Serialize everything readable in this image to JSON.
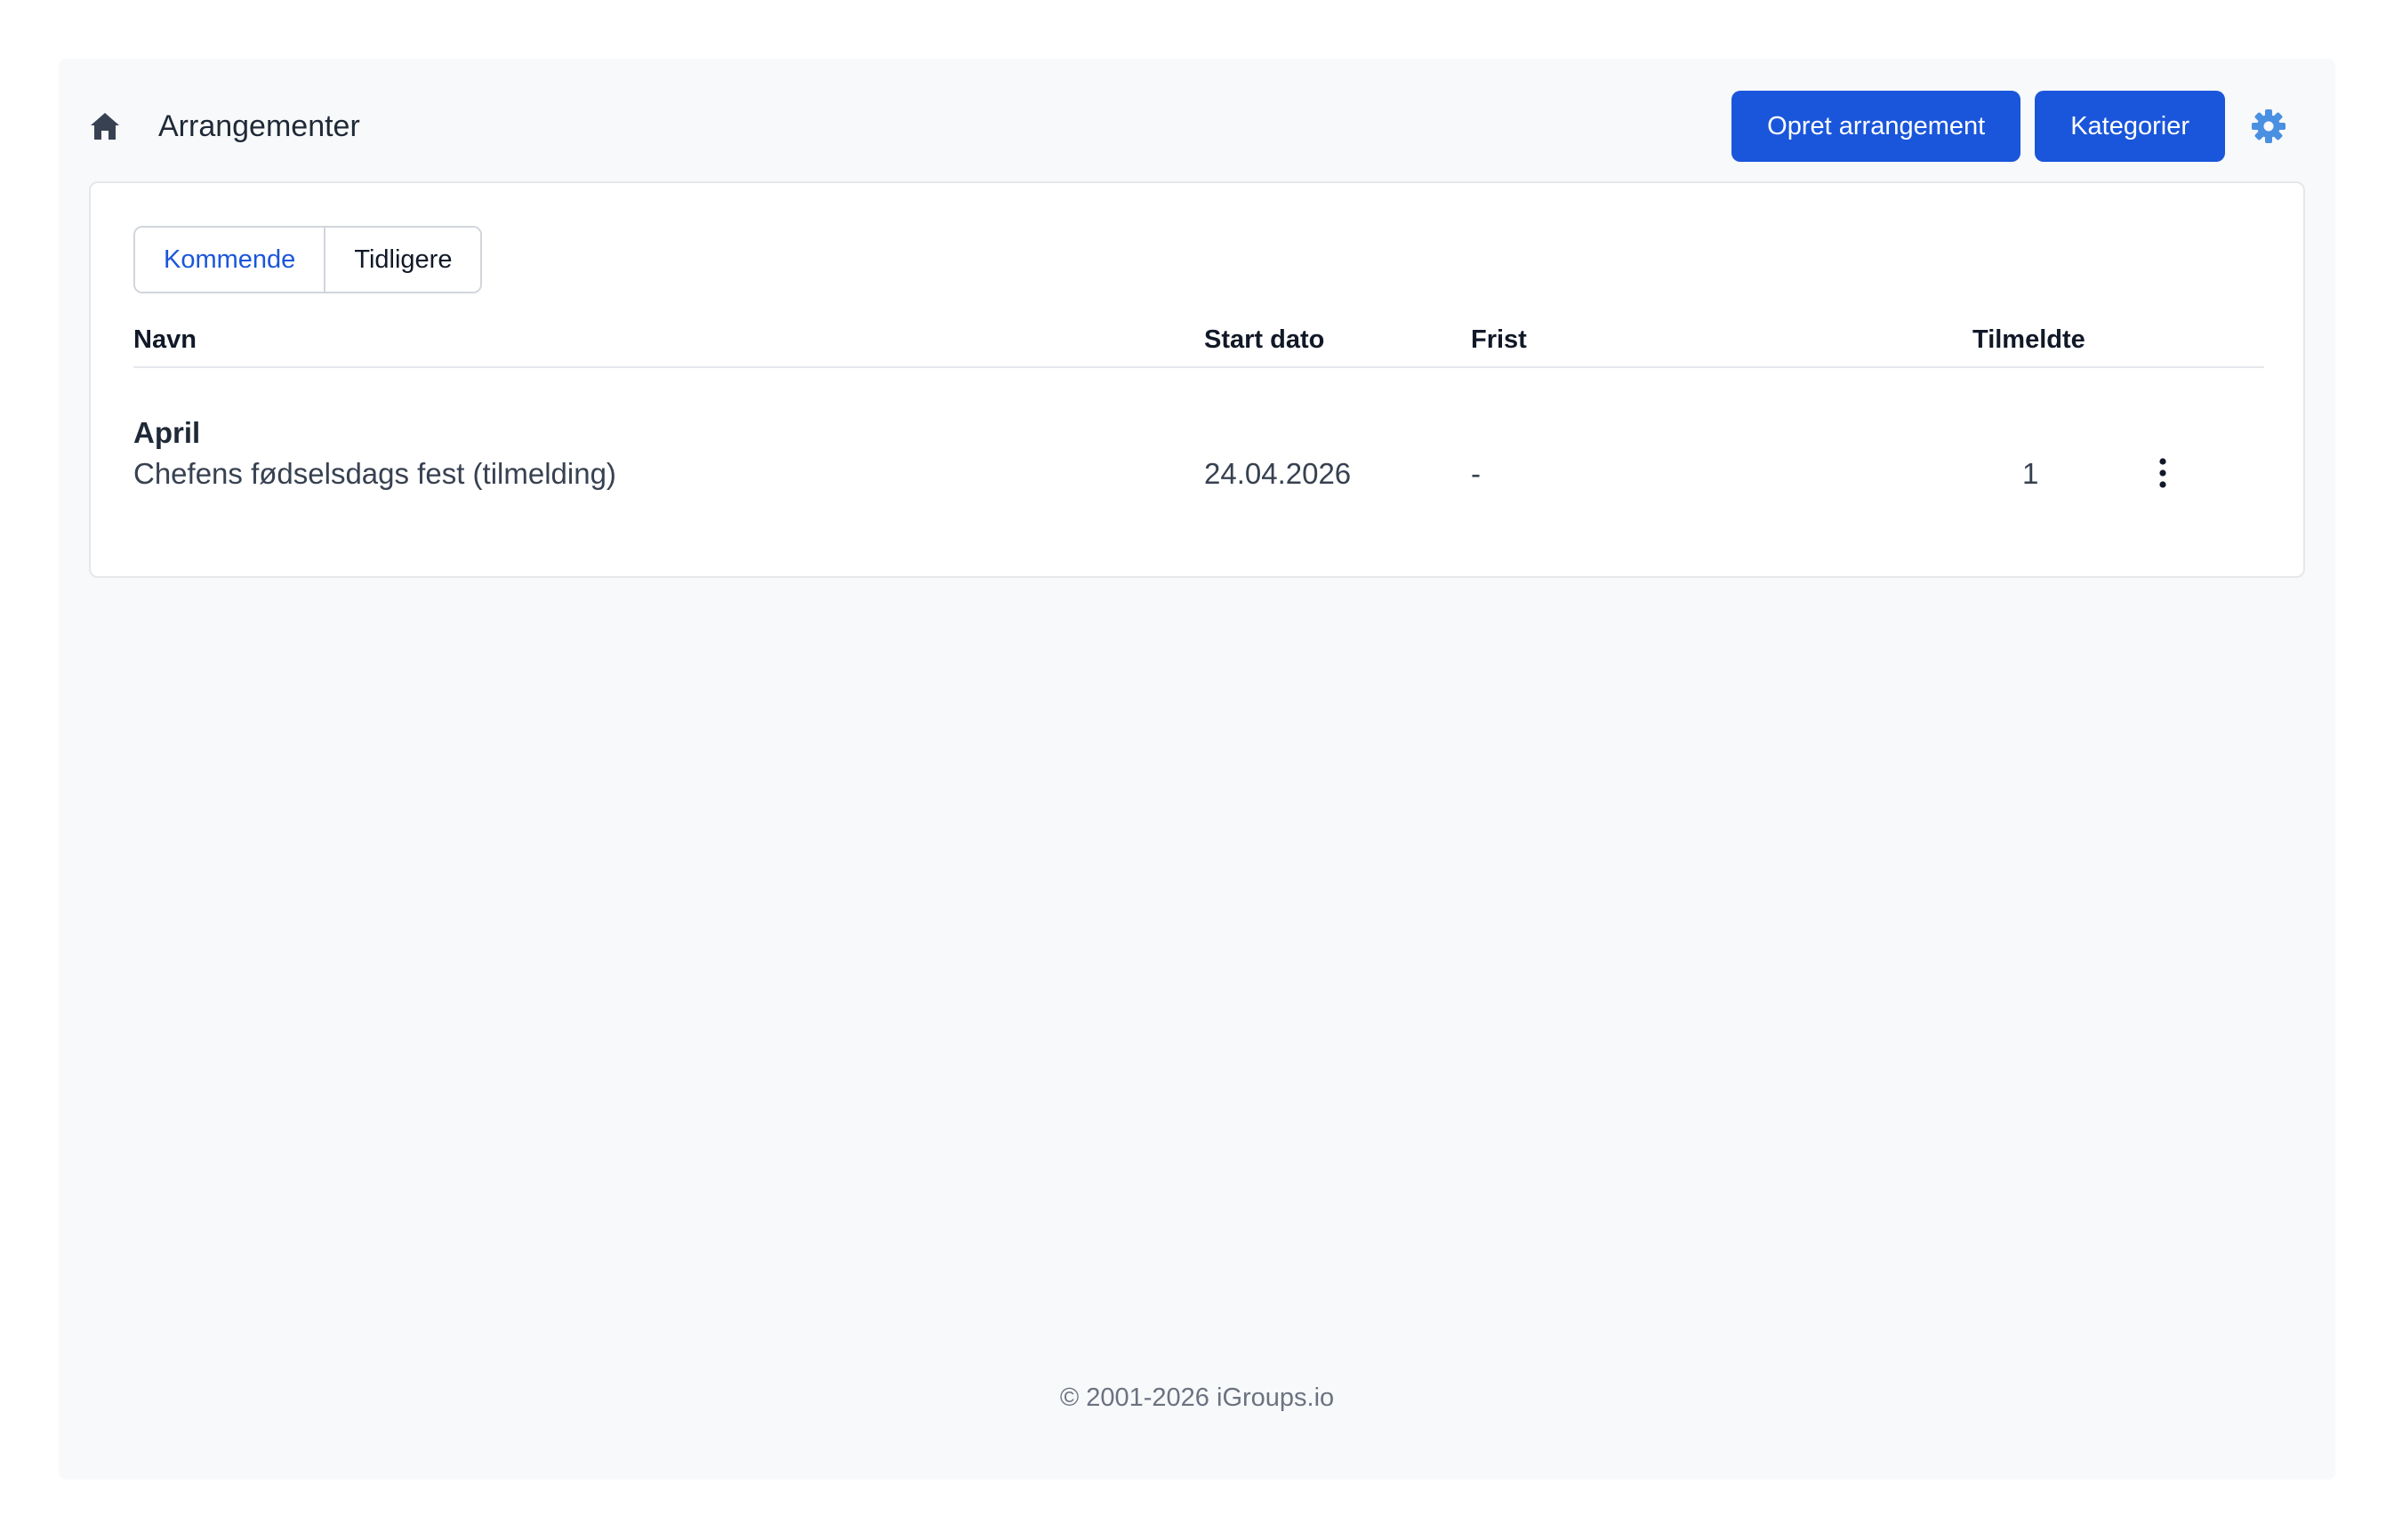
{
  "header": {
    "title": "Arrangementer",
    "create_button": "Opret arrangement",
    "categories_button": "Kategorier",
    "icons": {
      "home": "home-icon",
      "settings": "gear-icon"
    }
  },
  "tabs": [
    {
      "label": "Kommende",
      "active": true
    },
    {
      "label": "Tidligere",
      "active": false
    }
  ],
  "table": {
    "columns": [
      "Navn",
      "Start dato",
      "Frist",
      "Tilmeldte"
    ],
    "rows": [
      {
        "month": "April",
        "name": "Chefens fødselsdags fest (tilmelding)",
        "start_date": "24.04.2026",
        "deadline": "-",
        "registered": "1",
        "menu_icon": "kebab-menu-icon"
      }
    ]
  },
  "footer": {
    "copyright": "© 2001-2026 iGroups.io"
  },
  "colors": {
    "primary": "#1a56db",
    "gear": "#4a90e2",
    "background": "#f8f9fb"
  }
}
